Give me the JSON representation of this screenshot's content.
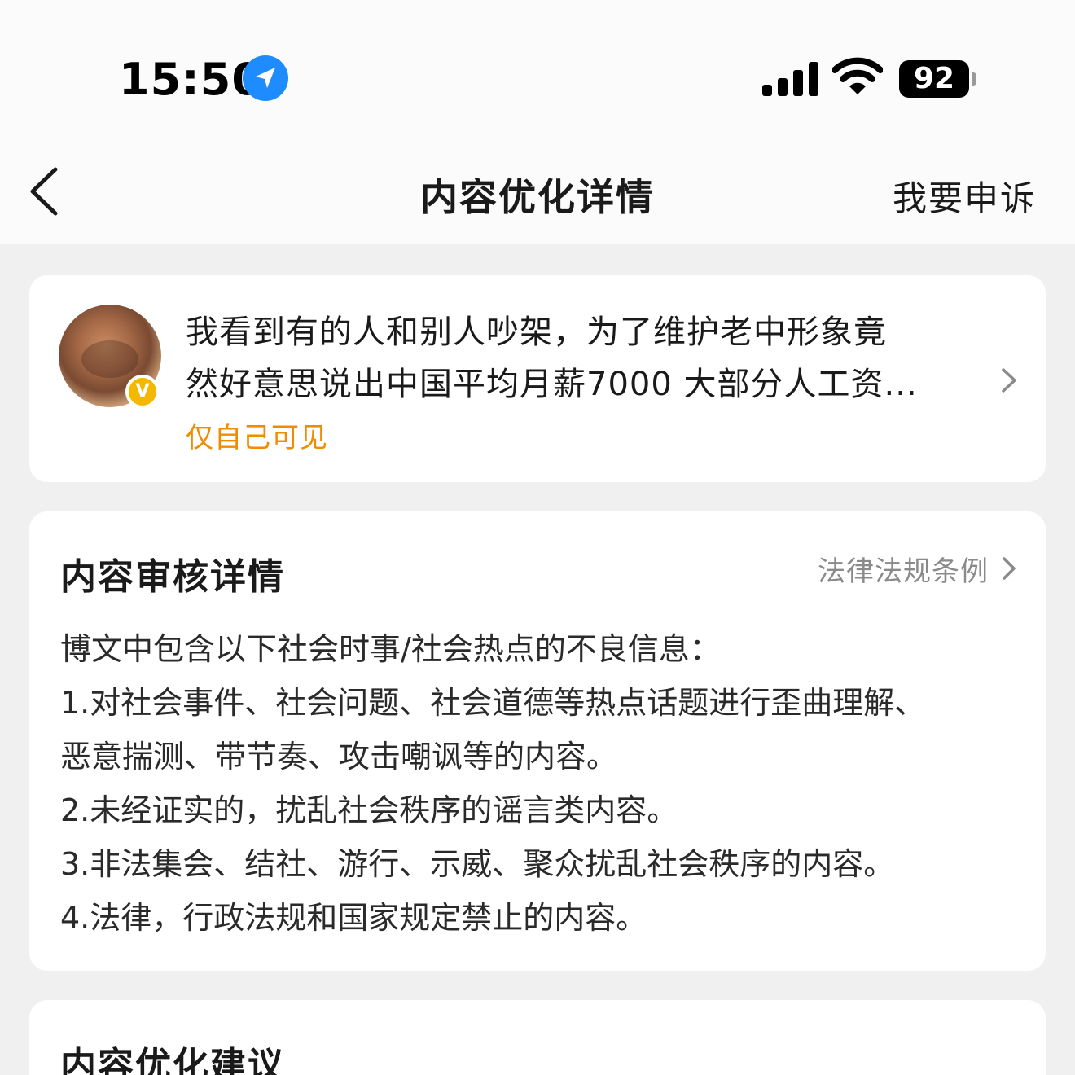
{
  "status_bar": {
    "time": "15:50",
    "battery": "92",
    "icons": [
      "location-arrow-icon",
      "cellular-signal-icon",
      "wifi-icon",
      "battery-icon"
    ]
  },
  "nav": {
    "title": "内容优化详情",
    "appeal_label": "我要申诉",
    "back_icon": "chevron-left-icon"
  },
  "post": {
    "lines": [
      "我看到有的人和别人吵架，为了维护老中形象竟",
      "然好意思说出中国平均月薪7000 大部分人工资..."
    ],
    "visibility": "仅自己可见",
    "badge": "V",
    "accent_color": "#f08c00"
  },
  "review": {
    "title": "内容审核详情",
    "laws_link": "法律法规条例",
    "lines": [
      "博文中包含以下社会时事/社会热点的不良信息：",
      "1.对社会事件、社会问题、社会道德等热点话题进行歪曲理解、",
      "恶意揣测、带节奏、攻击嘲讽等的内容。",
      "2.未经证实的，扰乱社会秩序的谣言类内容。",
      "3.非法集会、结社、游行、示威、聚众扰乱社会秩序的内容。",
      "4.法律，行政法规和国家规定禁止的内容。"
    ]
  },
  "suggestion": {
    "title": "内容优化建议"
  }
}
